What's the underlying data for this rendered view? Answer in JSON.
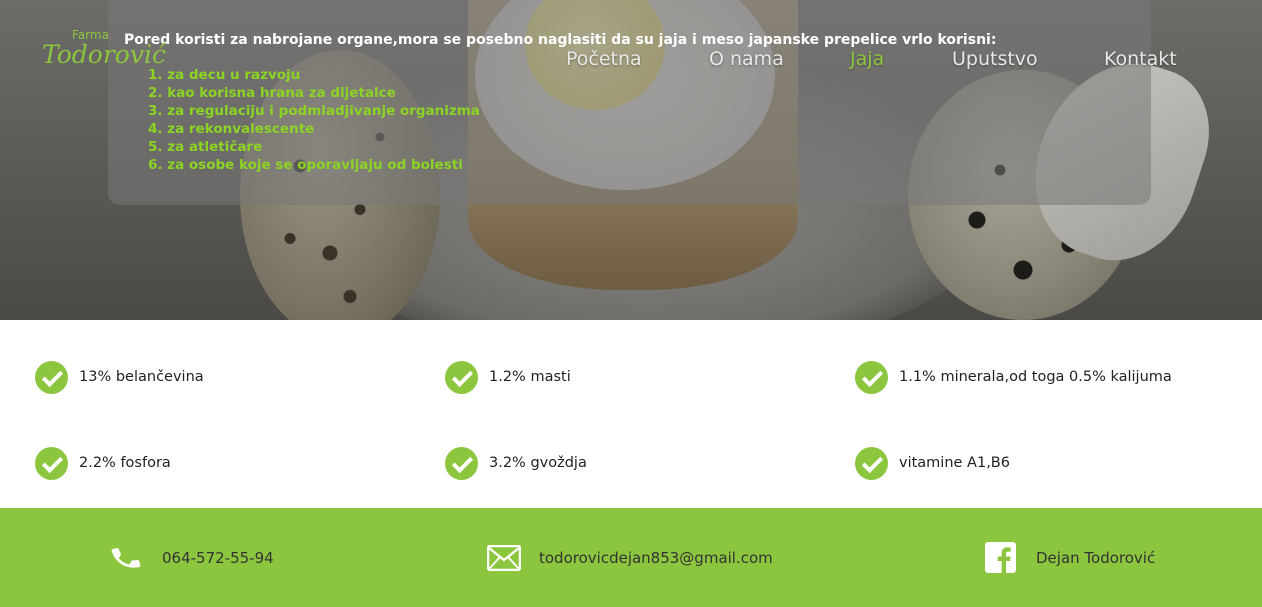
{
  "logo": {
    "small": "Farma",
    "big": "Todorović"
  },
  "nav": {
    "items": [
      {
        "label": "Početna"
      },
      {
        "label": "O nama"
      },
      {
        "label": "Jaja"
      },
      {
        "label": "Uputstvo"
      },
      {
        "label": "Kontakt"
      }
    ],
    "active": "Jaja"
  },
  "hero": {
    "intro": "Pored koristi za nabrojane organe,mora se posebno naglasiti da su jaja i meso japanske prepelice vrlo korisni:",
    "benefits": [
      "1. za decu u razvoju",
      "2. kao korisna hrana za dijetalce",
      "3. za regulaciju i podmladjivanje organizma",
      "4. za rekonvalescente",
      "5. za atletičare",
      "6. za osobe koje se oporavljaju od bolesti"
    ]
  },
  "features": [
    {
      "label": "13% belančevina",
      "icon": "check-circle-icon"
    },
    {
      "label": "1.2% masti",
      "icon": "check-circle-icon"
    },
    {
      "label": "1.1% minerala,od toga 0.5% kalijuma",
      "icon": "check-circle-icon"
    },
    {
      "label": "2.2% fosfora",
      "icon": "check-circle-icon"
    },
    {
      "label": "3.2% gvoždja",
      "icon": "check-circle-icon"
    },
    {
      "label": "vitamine A1,B6",
      "icon": "check-circle-icon"
    }
  ],
  "footer": {
    "phone": "064-572-55-94",
    "email": "todorovicdejan853@gmail.com",
    "facebook": "Dejan Todorović"
  },
  "colors": {
    "accent": "#8cc63f",
    "benefit_text": "#8cd424",
    "footer_bg": "#8cc63f"
  }
}
